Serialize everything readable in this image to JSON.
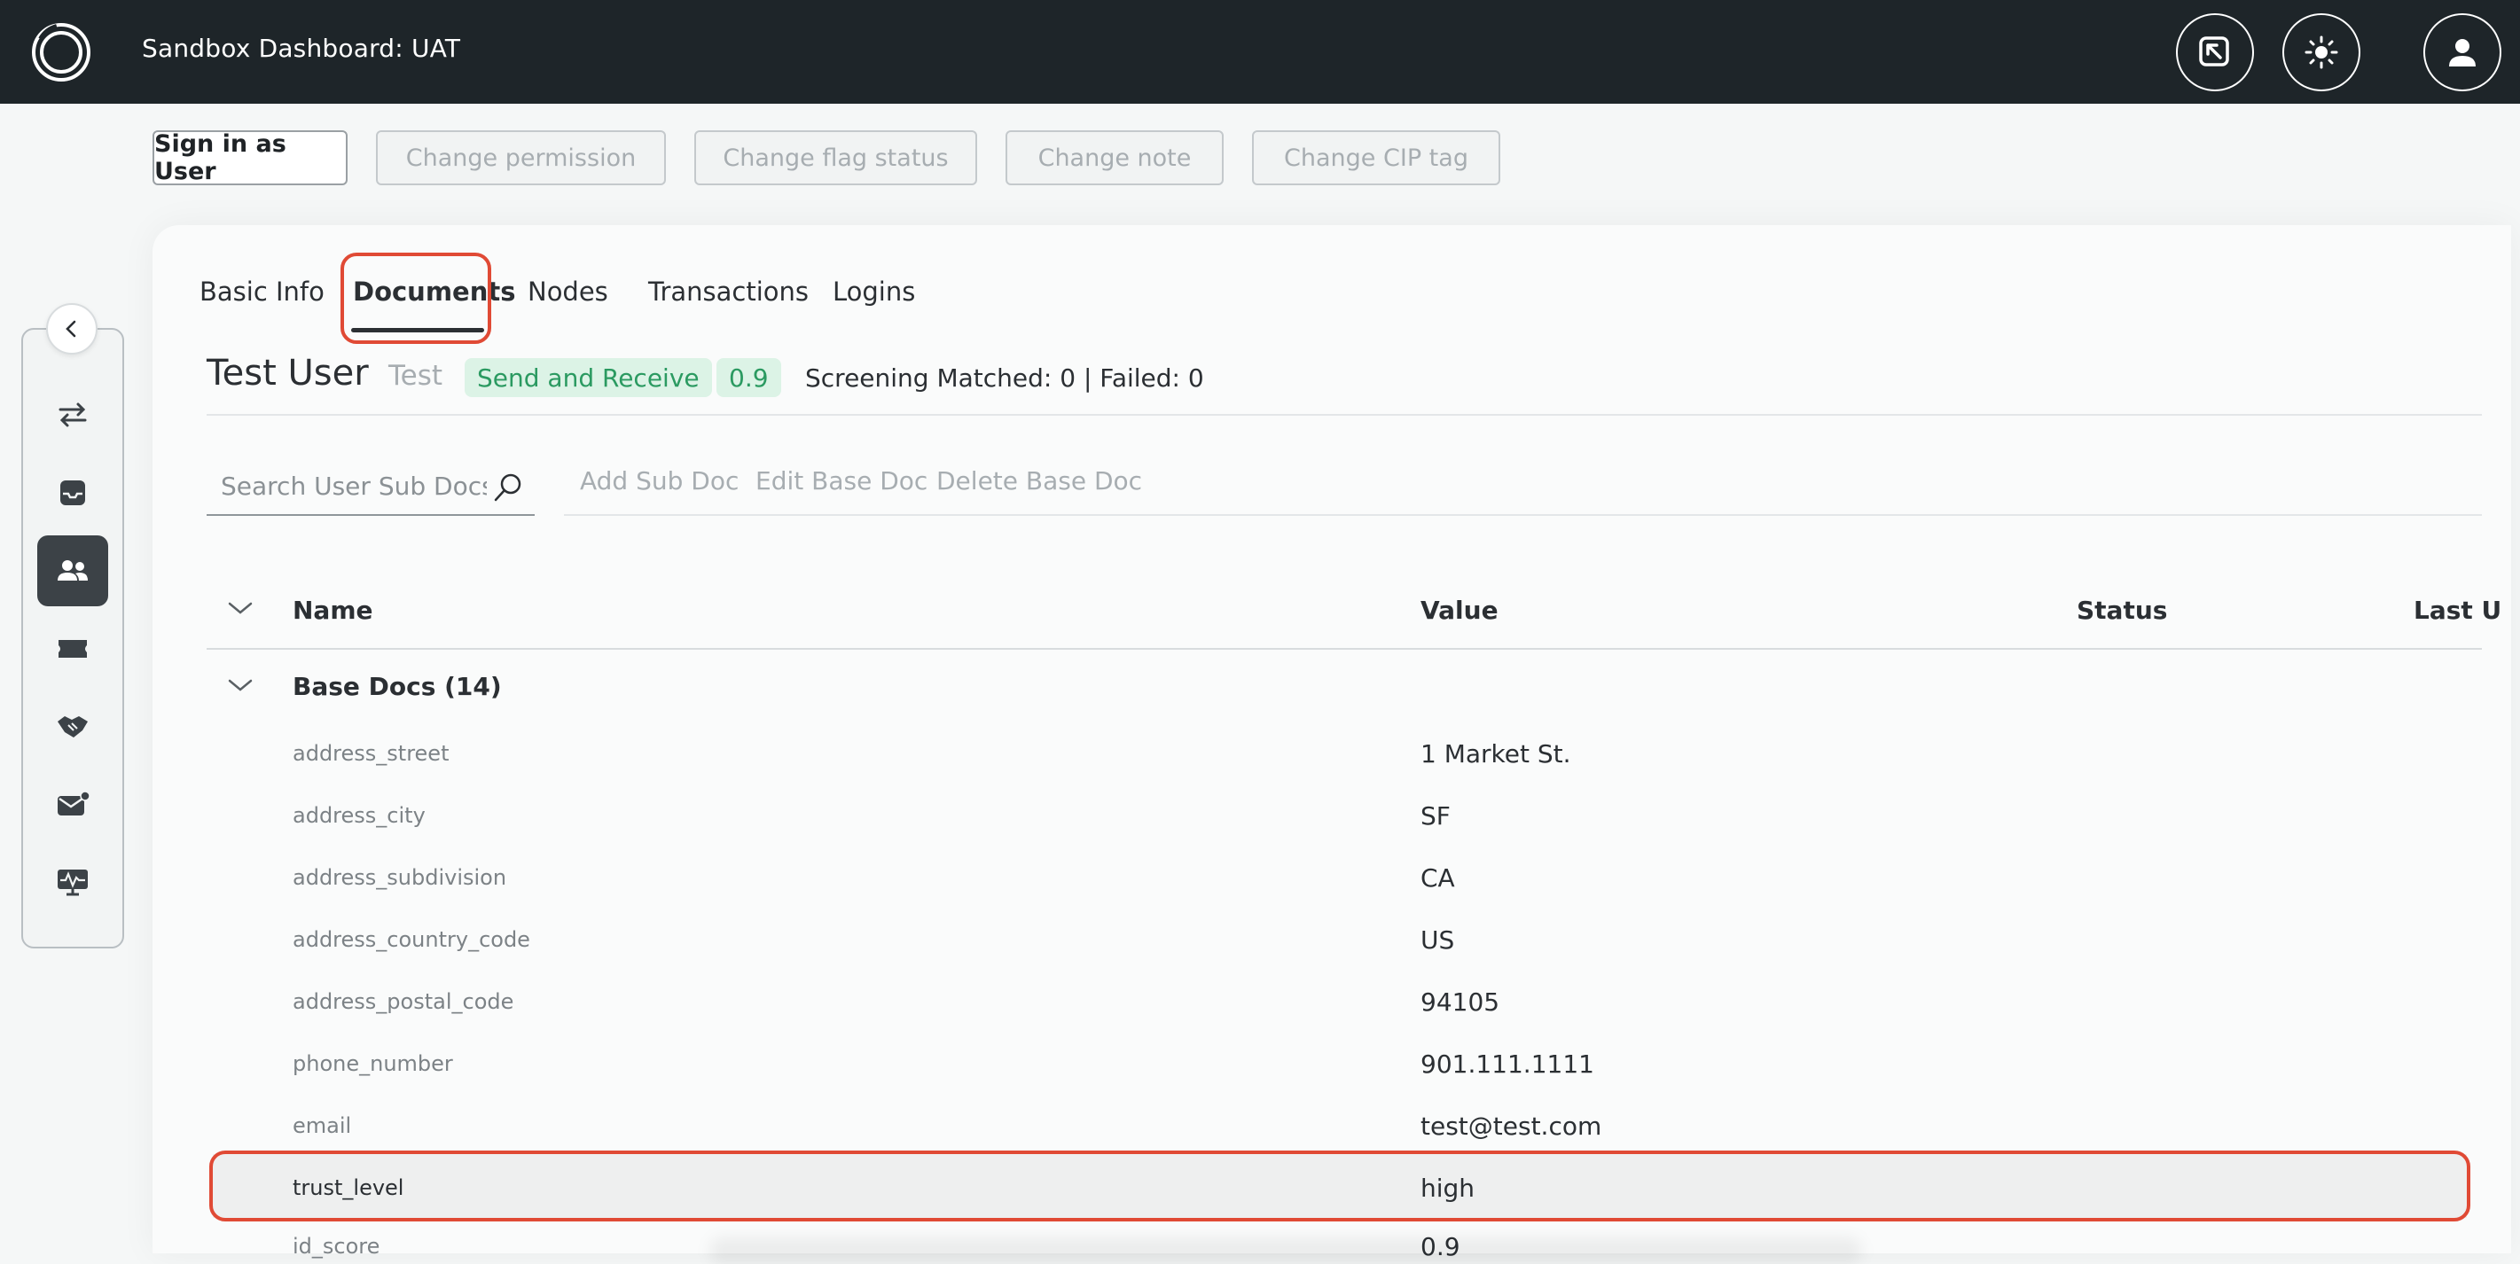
{
  "header": {
    "title": "Sandbox Dashboard: UAT",
    "icons": [
      "external-link-icon",
      "sun-icon",
      "user-avatar-icon"
    ]
  },
  "actions": {
    "sign_in": "Sign in as User",
    "change_permission": "Change permission",
    "change_flag": "Change flag status",
    "change_note": "Change note",
    "change_cip": "Change CIP tag"
  },
  "sidebar": {
    "items": [
      "transfer-icon",
      "inbox-icon",
      "users-icon",
      "ticket-icon",
      "handshake-icon",
      "mail-icon",
      "monitor-icon"
    ],
    "active": "users-icon"
  },
  "tabs": [
    "Basic Info",
    "Documents",
    "Nodes",
    "Transactions",
    "Logins"
  ],
  "active_tab": "Documents",
  "user": {
    "name": "Test User",
    "tag": "Test",
    "permission_badge": "Send and Receive",
    "score_badge": "0.9",
    "screening": "Screening Matched: 0 | Failed: 0"
  },
  "toolbar": {
    "search_placeholder": "Search User Sub Docs",
    "add_sub_doc": "Add Sub Doc",
    "edit_base_doc": "Edit Base Doc",
    "delete_base_doc": "Delete Base Doc"
  },
  "table": {
    "columns": [
      "Name",
      "Value",
      "Status",
      "Last U"
    ],
    "group": "Base Docs (14)",
    "rows": [
      {
        "name": "address_street",
        "value": "1 Market St."
      },
      {
        "name": "address_city",
        "value": "SF"
      },
      {
        "name": "address_subdivision",
        "value": "CA"
      },
      {
        "name": "address_country_code",
        "value": "US"
      },
      {
        "name": "address_postal_code",
        "value": "94105"
      },
      {
        "name": "phone_number",
        "value": "901.111.1111"
      },
      {
        "name": "email",
        "value": "test@test.com"
      },
      {
        "name": "trust_level",
        "value": "high"
      },
      {
        "name": "id_score",
        "value": "0.9"
      }
    ]
  },
  "colors": {
    "topbar": "#1e2529",
    "highlight": "#e04a35",
    "badge_bg": "#dcf3e6",
    "badge_text": "#2b9a61"
  }
}
